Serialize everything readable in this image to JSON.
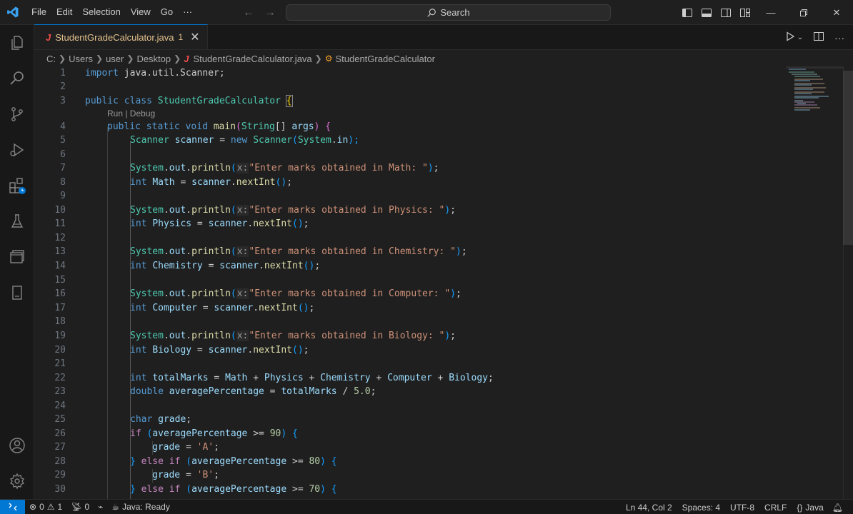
{
  "menu": [
    "File",
    "Edit",
    "Selection",
    "View",
    "Go"
  ],
  "menu_more": "···",
  "search": {
    "label": "Search"
  },
  "tab": {
    "file_icon": "J",
    "filename": "StudentGradeCalculator.java",
    "badge": "1"
  },
  "breadcrumb": {
    "parts": [
      "C:",
      "Users",
      "user",
      "Desktop"
    ],
    "file_icon": "J",
    "file": "StudentGradeCalculator.java",
    "symbol": "StudentGradeCalculator"
  },
  "codelens": "Run | Debug",
  "line_numbers": [
    "1",
    "2",
    "3",
    "4",
    "5",
    "6",
    "7",
    "8",
    "9",
    "10",
    "11",
    "12",
    "13",
    "14",
    "15",
    "16",
    "17",
    "18",
    "19",
    "20",
    "21",
    "22",
    "23",
    "24",
    "25",
    "26",
    "27",
    "28",
    "29",
    "30"
  ],
  "code": {
    "l1": [
      "import",
      " java.util.Scanner;"
    ],
    "l3": [
      "public",
      " ",
      "class",
      " ",
      "StudentGradeCalculator",
      " ",
      "{"
    ],
    "l4": [
      "public",
      " ",
      "static",
      " ",
      "void",
      " ",
      "main",
      "(",
      "String",
      "[] ",
      "args",
      ") ",
      "{"
    ],
    "l5": [
      "Scanner",
      " ",
      "scanner",
      " = ",
      "new",
      " ",
      "Scanner",
      "(",
      "System",
      ".",
      "in",
      ");"
    ],
    "prompts": [
      {
        "hint": "x:",
        "text": "\"Enter marks obtained in Math: \"",
        "var": "Math"
      },
      {
        "hint": "x:",
        "text": "\"Enter marks obtained in Physics: \"",
        "var": "Physics"
      },
      {
        "hint": "x:",
        "text": "\"Enter marks obtained in Chemistry: \"",
        "var": "Chemistry"
      },
      {
        "hint": "x:",
        "text": "\"Enter marks obtained in Computer: \"",
        "var": "Computer"
      },
      {
        "hint": "x:",
        "text": "\"Enter marks obtained in Biology: \"",
        "var": "Biology"
      }
    ],
    "l22": [
      "int",
      " ",
      "totalMarks",
      " = ",
      "Math",
      " + ",
      "Physics",
      " + ",
      "Chemistry",
      " + ",
      "Computer",
      " + ",
      "Biology",
      ";"
    ],
    "l23": [
      "double",
      " ",
      "averagePercentage",
      " = ",
      "totalMarks",
      " / ",
      "5.0",
      ";"
    ],
    "l25": [
      "char",
      " ",
      "grade",
      ";"
    ],
    "l26": [
      "if",
      " ",
      "(",
      "averagePercentage",
      " >= ",
      "90",
      ") ",
      "{"
    ],
    "l27": [
      "grade",
      " = ",
      "'A'",
      ";"
    ],
    "l28": [
      "}",
      " ",
      "else",
      " ",
      "if",
      " ",
      "(",
      "averagePercentage",
      " >= ",
      "80",
      ") ",
      "{"
    ],
    "l29": [
      "grade",
      " = ",
      "'B'",
      ";"
    ],
    "l30": [
      "}",
      " ",
      "else",
      " ",
      "if",
      " ",
      "(",
      "averagePercentage",
      " >= ",
      "70",
      ") ",
      "{"
    ]
  },
  "status": {
    "errors": "0",
    "warnings": "1",
    "ports": "0",
    "java_status": "Java: Ready",
    "position": "Ln 44, Col 2",
    "spaces": "Spaces: 4",
    "encoding": "UTF-8",
    "eol": "CRLF",
    "language": "Java"
  },
  "colors": {
    "accent": "#0078d4",
    "keyword": "#569cd6",
    "type": "#4ec9b0",
    "string": "#ce9178",
    "variable": "#9cdcfe",
    "function": "#dcdcaa"
  }
}
